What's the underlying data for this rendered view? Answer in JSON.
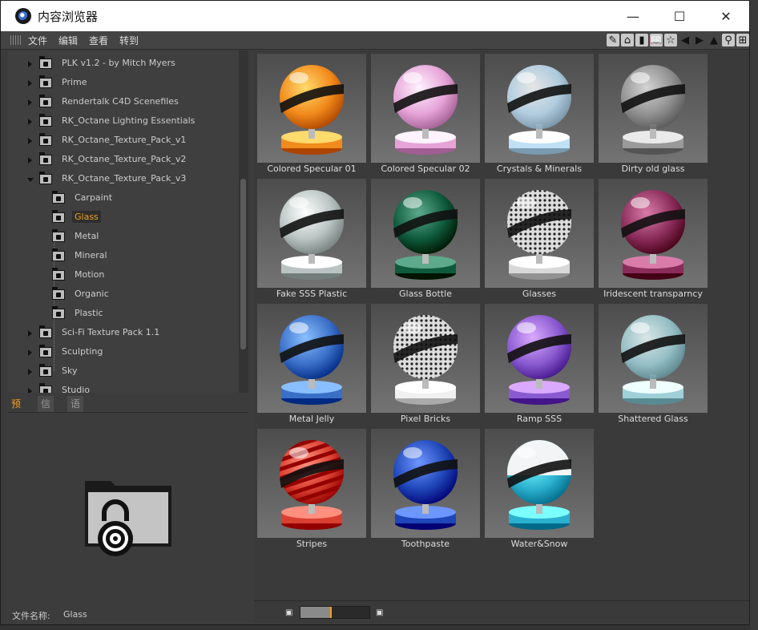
{
  "window": {
    "title": "内容浏览器",
    "min_label": "—",
    "max_label": "☐",
    "close_label": "✕"
  },
  "menu": [
    "文件",
    "编辑",
    "查看",
    "转到"
  ],
  "toolbar_icons": [
    "pencil-icon",
    "home-icon",
    "bookmark-icon",
    "book-icon",
    "star-icon",
    "back-arrow-icon",
    "forward-arrow-icon",
    "up-arrow-icon",
    "search-icon",
    "new-icon"
  ],
  "tree": [
    {
      "label": "PLK v1.2 - by Mitch Myers",
      "level": 0,
      "expanded": false
    },
    {
      "label": "Prime",
      "level": 0,
      "expanded": false
    },
    {
      "label": "Rendertalk C4D Scenefiles",
      "level": 0,
      "expanded": false
    },
    {
      "label": "RK_Octane Lighting Essentials",
      "level": 0,
      "expanded": false
    },
    {
      "label": "RK_Octane_Texture_Pack_v1",
      "level": 0,
      "expanded": false
    },
    {
      "label": "RK_Octane_Texture_Pack_v2",
      "level": 0,
      "expanded": false
    },
    {
      "label": "RK_Octane_Texture_Pack_v3",
      "level": 0,
      "expanded": true
    },
    {
      "label": "Carpaint",
      "level": 1
    },
    {
      "label": "Glass",
      "level": 1,
      "selected": true
    },
    {
      "label": "Metal",
      "level": 1
    },
    {
      "label": "Mineral",
      "level": 1
    },
    {
      "label": "Motion",
      "level": 1
    },
    {
      "label": "Organic",
      "level": 1
    },
    {
      "label": "Plastic",
      "level": 1
    },
    {
      "label": "Sci-Fi Texture Pack 1.1",
      "level": 0,
      "expanded": false
    },
    {
      "label": "Sculpting",
      "level": 0,
      "expanded": false
    },
    {
      "label": "Sky",
      "level": 0,
      "expanded": false
    },
    {
      "label": "Studio",
      "level": 0,
      "expanded": false
    }
  ],
  "tabs": [
    {
      "label": "预览",
      "active": true
    },
    {
      "label": "信息",
      "active": false
    },
    {
      "label": "语言",
      "active": false
    }
  ],
  "preview": {
    "filename_label": "文件名称:",
    "filename_value": "Glass"
  },
  "materials": [
    {
      "name": "Colored Specular 01",
      "color": "#f28a1c",
      "style": "solid"
    },
    {
      "name": "Colored Specular 02",
      "color": "#e6a3d8",
      "style": "solid"
    },
    {
      "name": "Crystals & Minerals",
      "color": "#bfe0f5",
      "style": "glass"
    },
    {
      "name": "Dirty old glass",
      "color": "#9a9a9a",
      "style": "glass"
    },
    {
      "name": "Fake SSS Plastic",
      "color": "#b9c4c2",
      "style": "solid"
    },
    {
      "name": "Glass Bottle",
      "color": "#0e5a3c",
      "style": "solid"
    },
    {
      "name": "Glasses",
      "color": "#d8d8d8",
      "style": "pattern"
    },
    {
      "name": "Iridescent transparncy",
      "color": "#8a2c5a",
      "style": "solid"
    },
    {
      "name": "Metal Jelly",
      "color": "#3a6fc8",
      "style": "metal"
    },
    {
      "name": "Pixel Bricks",
      "color": "#f0f0f0",
      "style": "pattern"
    },
    {
      "name": "Ramp SSS",
      "color": "#8a5ad0",
      "style": "solid"
    },
    {
      "name": "Shattered Glass",
      "color": "#9fd0d8",
      "style": "glass"
    },
    {
      "name": "Stripes",
      "color": "#d94030",
      "style": "stripes"
    },
    {
      "name": "Toothpaste",
      "color": "#1e46b8",
      "style": "solid"
    },
    {
      "name": "Water&Snow",
      "color": "#2bb0cf",
      "style": "snow"
    }
  ],
  "zoom": {
    "level": 0.45,
    "min_icon": "small-thumb-icon",
    "max_icon": "large-thumb-icon"
  }
}
